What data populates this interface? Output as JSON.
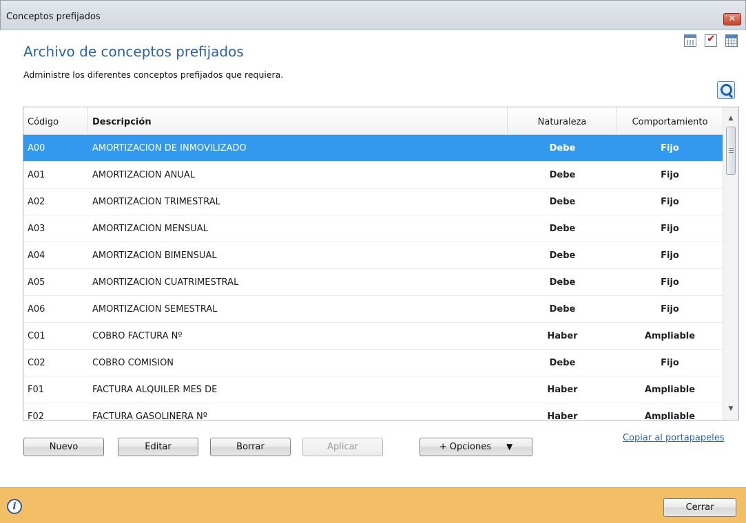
{
  "window": {
    "title": "Conceptos prefijados",
    "close_glyph": "✕"
  },
  "header": {
    "title": "Archivo de conceptos prefijados",
    "subtitle": "Administre los diferentes conceptos prefijados que requiera.",
    "icons": [
      "calendar-icon",
      "checklist-icon",
      "grid-calendar-icon"
    ],
    "search_icon": "search-icon"
  },
  "table": {
    "columns": {
      "code": "Código",
      "description": "Descripción",
      "nature": "Naturaleza",
      "behavior": "Comportamiento"
    },
    "selected_row": 0,
    "rows": [
      {
        "code": "A00",
        "description": "AMORTIZACION DE INMOVILIZADO",
        "nature": "Debe",
        "behavior": "Fijo"
      },
      {
        "code": "A01",
        "description": "AMORTIZACION ANUAL",
        "nature": "Debe",
        "behavior": "Fijo"
      },
      {
        "code": "A02",
        "description": "AMORTIZACION TRIMESTRAL",
        "nature": "Debe",
        "behavior": "Fijo"
      },
      {
        "code": "A03",
        "description": "AMORTIZACION MENSUAL",
        "nature": "Debe",
        "behavior": "Fijo"
      },
      {
        "code": "A04",
        "description": "AMORTIZACION BIMENSUAL",
        "nature": "Debe",
        "behavior": "Fijo"
      },
      {
        "code": "A05",
        "description": "AMORTIZACION CUATRIMESTRAL",
        "nature": "Debe",
        "behavior": "Fijo"
      },
      {
        "code": "A06",
        "description": "AMORTIZACION SEMESTRAL",
        "nature": "Debe",
        "behavior": "Fijo"
      },
      {
        "code": "C01",
        "description": "COBRO FACTURA Nº",
        "nature": "Haber",
        "behavior": "Ampliable"
      },
      {
        "code": "C02",
        "description": "COBRO COMISION",
        "nature": "Debe",
        "behavior": "Fijo"
      },
      {
        "code": "F01",
        "description": "FACTURA ALQUILER MES DE",
        "nature": "Haber",
        "behavior": "Ampliable"
      },
      {
        "code": "F02",
        "description": "FACTURA GASOLINERA Nº",
        "nature": "Haber",
        "behavior": "Ampliable"
      }
    ]
  },
  "actions": {
    "new": "Nuevo",
    "edit": "Editar",
    "delete": "Borrar",
    "apply": "Aplicar",
    "options": "+ Opciones",
    "copy_link": "Copiar al portapapeles"
  },
  "footer": {
    "info_glyph": "i",
    "close": "Cerrar"
  },
  "colors": {
    "heading": "#2b62a6",
    "selected_row": "#3399ee",
    "footer": "#f3bf66",
    "link": "#2a64b4"
  }
}
